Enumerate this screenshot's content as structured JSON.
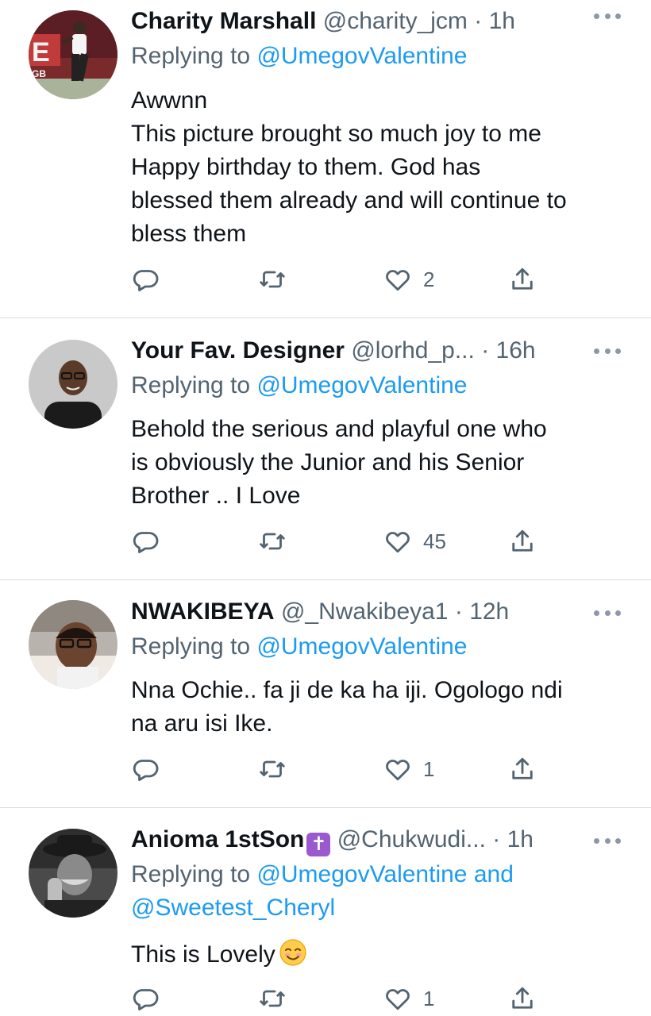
{
  "tweets": [
    {
      "name": "Charity Marshall",
      "badge": "",
      "handle": "@charity_jcm",
      "dot": "·",
      "time": "1h",
      "replying_prefix": "Replying to",
      "mentions": [
        "@UmegovValentine"
      ],
      "mention_joiner": "",
      "body_lines": [
        "Awwnn",
        "This picture brought so much joy to me",
        "Happy birthday to them. God has",
        "blessed them already and will continue to",
        "bless them"
      ],
      "emoji": "",
      "reply_count": "",
      "retweet_count": "",
      "like_count": "2",
      "avatar_icon": "avatar-photo-woman-posing"
    },
    {
      "name": "Your Fav. Designer",
      "badge": "",
      "handle": "@lorhd_p...",
      "dot": "·",
      "time": "16h",
      "replying_prefix": "Replying to",
      "mentions": [
        "@UmegovValentine"
      ],
      "mention_joiner": "",
      "body_lines": [
        "Behold the serious and playful one who",
        "is obviously the Junior and his Senior",
        "Brother .. I Love"
      ],
      "emoji": "",
      "reply_count": "",
      "retweet_count": "",
      "like_count": "45",
      "avatar_icon": "avatar-photo-man-glasses"
    },
    {
      "name": "NWAKIBEYA",
      "badge": "",
      "handle": "@_Nwakibeya1",
      "dot": "·",
      "time": "12h",
      "replying_prefix": "Replying to",
      "mentions": [
        "@UmegovValentine"
      ],
      "mention_joiner": "",
      "body_lines": [
        "Nna Ochie.. fa ji de ka ha iji. Ogologo ndi",
        "na aru isi Ike."
      ],
      "emoji": "",
      "reply_count": "",
      "retweet_count": "",
      "like_count": "1",
      "avatar_icon": "avatar-photo-man-selfie"
    },
    {
      "name": "Anioma 1stSon",
      "badge": "✝",
      "handle": "@Chukwudi...",
      "dot": "·",
      "time": "1h",
      "replying_prefix": "Replying to",
      "mentions": [
        "@UmegovValentine",
        "@Sweetest_Cheryl"
      ],
      "mention_joiner": "and",
      "body_lines": [
        "This is Lovely"
      ],
      "emoji": "smiling-face-emoji",
      "reply_count": "",
      "retweet_count": "",
      "like_count": "1",
      "avatar_icon": "avatar-photo-man-hat-bw"
    }
  ],
  "colors": {
    "link": "#1d9bf0",
    "secondary_text": "#536471",
    "primary_text": "#0f1419",
    "divider": "#d9dde1",
    "badge": "#9b59d0"
  }
}
